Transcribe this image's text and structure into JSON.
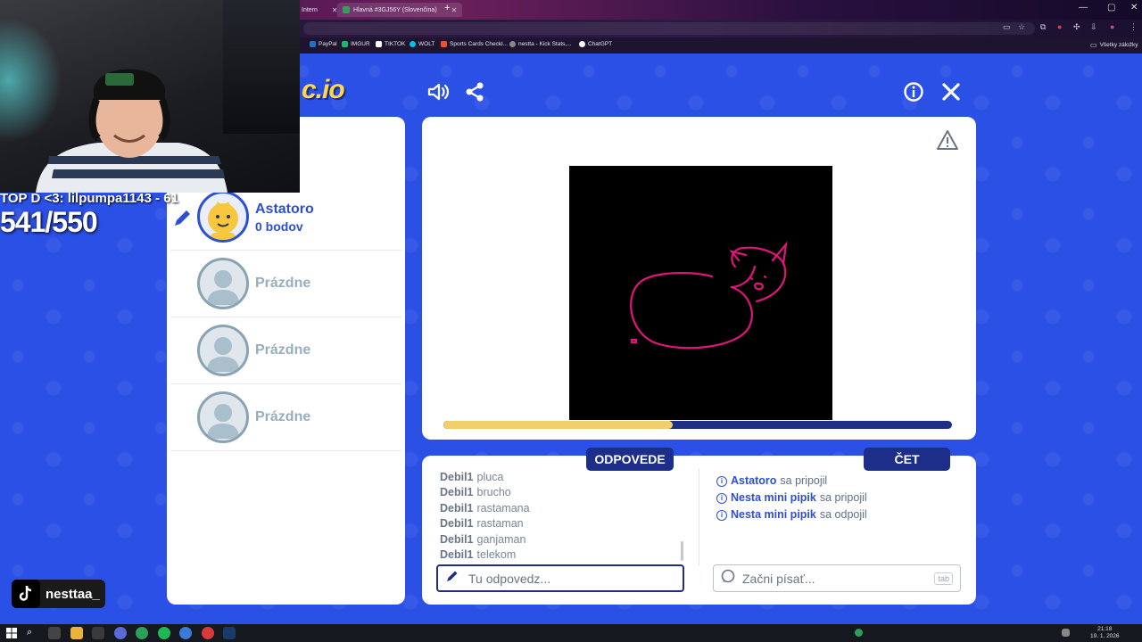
{
  "browser": {
    "tabs": [
      {
        "title": "Intern"
      },
      {
        "title": "Hlavná #3GJ56Y (Slovenčina)"
      }
    ],
    "bookmarks": [
      {
        "label": "PayPal",
        "color": "#1f72c8"
      },
      {
        "label": "IMGUR",
        "color": "#1bb76e"
      },
      {
        "label": "TIKTOK",
        "color": "#ffffff"
      },
      {
        "label": "WOLT",
        "color": "#00c2e8"
      },
      {
        "label": "Sports Cards Checkl...",
        "color": "#e8552a"
      },
      {
        "label": "nestta - Kick Stats,...",
        "color": "#888888"
      },
      {
        "label": "ChatGPT",
        "color": "#ffffff"
      }
    ],
    "all_bookmarks": "Všetky záložky"
  },
  "game": {
    "logo": "c.io",
    "players": [
      {
        "name": "Astatoro",
        "score": "0 bodov",
        "active": true
      },
      {
        "name": "Prázdne"
      },
      {
        "name": "Prázdne"
      },
      {
        "name": "Prázdne"
      }
    ],
    "timer_progress": 0.45,
    "answers_label": "ODPOVEDE",
    "chat_label": "ČET",
    "answers": [
      {
        "user": "Debil1",
        "text": "pluca"
      },
      {
        "user": "Debil1",
        "text": "brucho"
      },
      {
        "user": "Debil1",
        "text": "rastamana"
      },
      {
        "user": "Debil1",
        "text": "rastaman"
      },
      {
        "user": "Debil1",
        "text": "ganjaman"
      },
      {
        "user": "Debil1",
        "text": "telekom"
      }
    ],
    "chat": [
      {
        "user": "Astatoro",
        "text": "sa pripojil"
      },
      {
        "user": "Nesta mini pipik",
        "text": "sa pripojil"
      },
      {
        "user": "Nesta mini pipik",
        "text": "sa odpojil"
      }
    ],
    "answer_placeholder": "Tu odpovedz...",
    "chat_placeholder": "Začni písať...",
    "tab_hint": "tab",
    "colors": {
      "background": "#2b50e6",
      "accent": "#2e4fd0",
      "navy": "#1c2d8a",
      "timer": "#f1cf6b",
      "stroke": "#e0157a"
    }
  },
  "stream": {
    "top_donor": "TOP D <3: lilpumpa1143 - 61",
    "counter": "541/550",
    "tiktok_handle": "nesttaa_"
  },
  "taskbar": {
    "time": "21:18",
    "date": "19. 1. 2026"
  }
}
